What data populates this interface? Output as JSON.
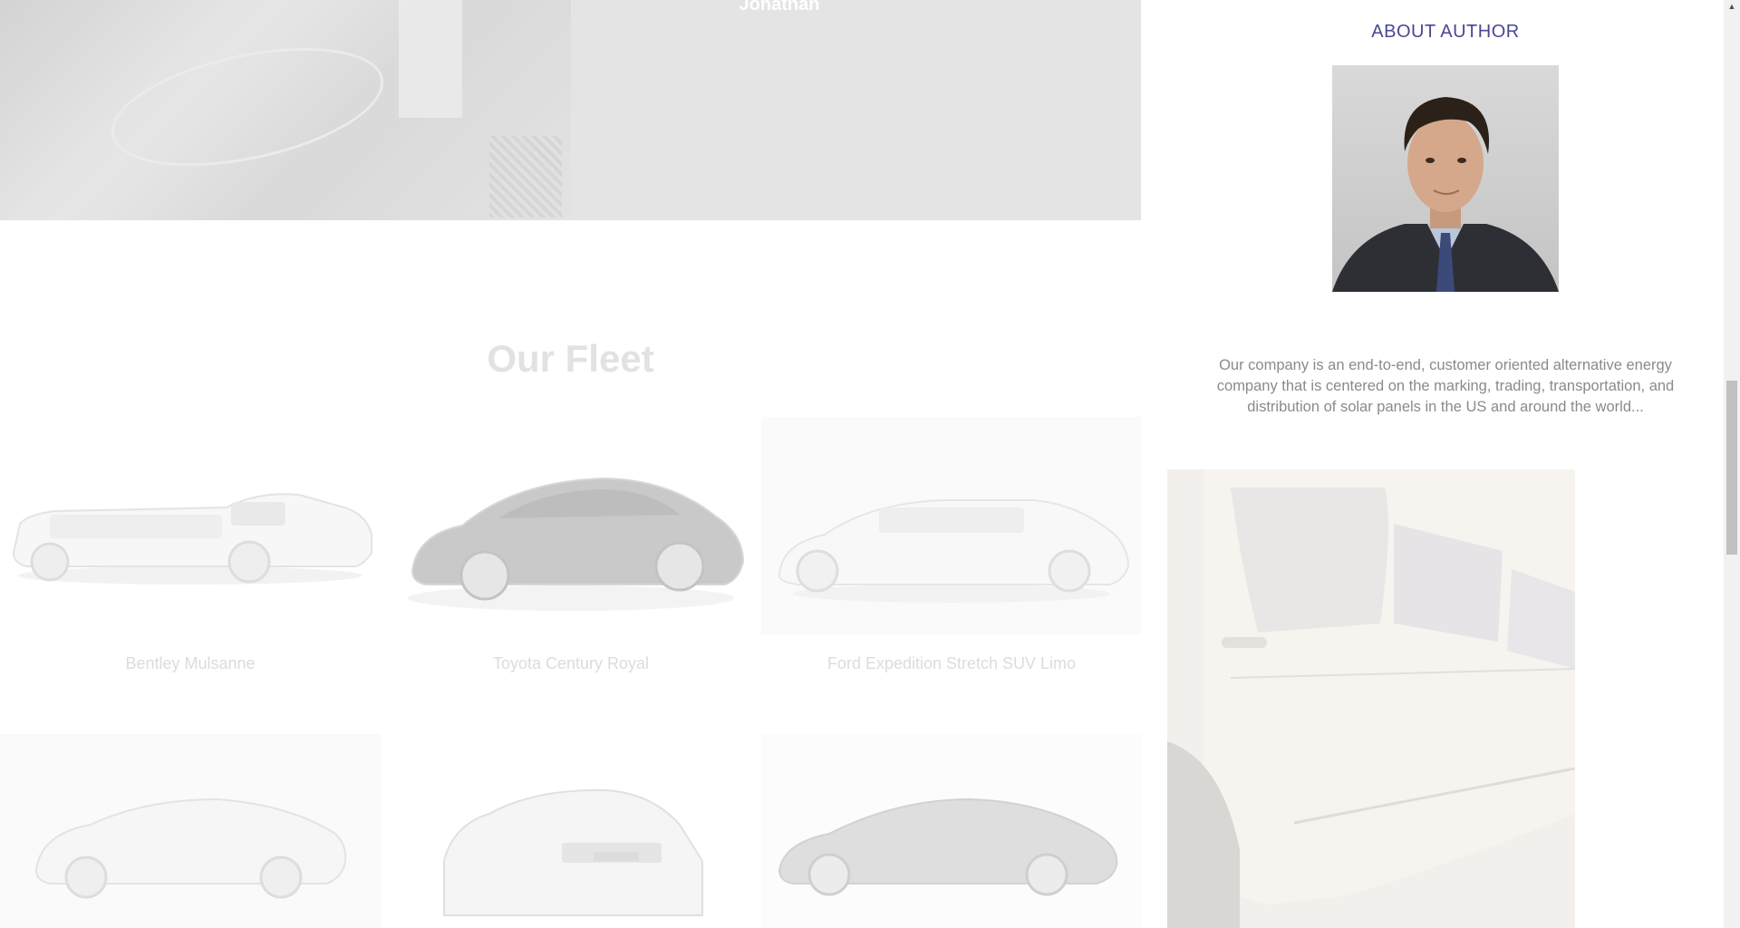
{
  "testimonial": {
    "author": "Jonathan"
  },
  "fleet": {
    "title": "Our Fleet",
    "cars": [
      {
        "name": "Bentley Mulsanne",
        "icon": "white-stretch-limo-image"
      },
      {
        "name": "Toyota Century Royal",
        "icon": "black-sedan-image"
      },
      {
        "name": "Ford Expedition Stretch SUV Limo",
        "icon": "white-sedan-image"
      },
      {
        "name": "",
        "icon": "white-coupe-image"
      },
      {
        "name": "",
        "icon": "white-sedan-rear-image"
      },
      {
        "name": "",
        "icon": "grey-coupe-image"
      }
    ]
  },
  "sidebar": {
    "about_title": "ABOUT AUTHOR",
    "about_text": "Our company is an end-to-end, customer oriented alternative energy company that is centered on the marking, trading, transportation, and distribution of solar panels in the US and around the world..."
  },
  "colors": {
    "accent": "#4a4694",
    "text_muted": "#8a8a8a",
    "band_bg": "#e4e4e4"
  }
}
